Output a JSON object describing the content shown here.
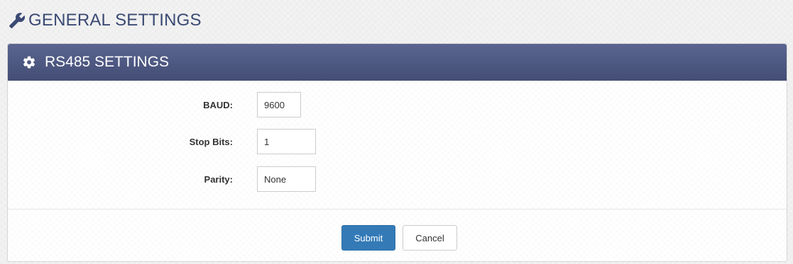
{
  "page": {
    "title": "GENERAL SETTINGS",
    "title_icon": "wrench-icon"
  },
  "panel": {
    "title": "RS485 SETTINGS",
    "title_icon": "gear-icon",
    "header_color": "#4b5580"
  },
  "form": {
    "baud": {
      "label": "BAUD:",
      "value": "9600"
    },
    "stop_bits": {
      "label": "Stop Bits:",
      "value": "1"
    },
    "parity": {
      "label": "Parity:",
      "value": "None"
    }
  },
  "actions": {
    "submit_label": "Submit",
    "cancel_label": "Cancel",
    "submit_color": "#337ab7"
  }
}
